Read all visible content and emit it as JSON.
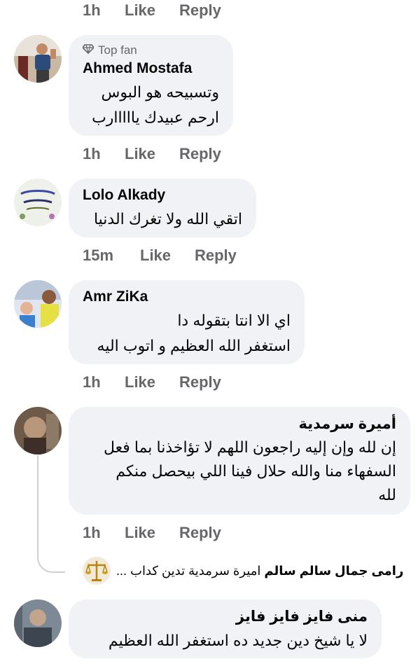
{
  "actions": {
    "like": "Like",
    "reply": "Reply"
  },
  "top_row": {
    "time": "1h"
  },
  "comments": [
    {
      "badge": "Top fan",
      "author": "Ahmed Mostafa",
      "lines": [
        "وتسبيحه هو البوس",
        "ارحم عبيدك يااااارب"
      ],
      "time": "1h"
    },
    {
      "author": "Lolo Alkady",
      "lines": [
        "اتقي الله ولا تغرك الدنيا"
      ],
      "time": "15m"
    },
    {
      "author": "Amr ZiKa",
      "lines": [
        "اي الا انتا بتقوله دا",
        "استغفر الله العظيم و اتوب اليه"
      ],
      "time": "1h"
    },
    {
      "author": "أميرة سرمدية",
      "lines": [
        "إن لله وإن إليه راجعون اللهم لا تؤاخذنا بما فعل",
        "السفهاء منا والله حلال فينا اللي بيحصل منكم",
        "لله"
      ],
      "time": "1h"
    },
    {
      "author": "منى فايز فايز فايز",
      "lines": [
        "لا يا شيخ دين جديد ده استغفر الله العظيم"
      ]
    }
  ],
  "reply_preview": {
    "author": "رامى جمال سالم سالم",
    "snippet": "اميرة سرمدية تدين كداب ..."
  },
  "icons": {
    "badge": "diamond-icon",
    "reply_avatar": "scales-icon"
  },
  "colors": {
    "bubble": "#f0f2f5",
    "meta": "#65676b",
    "text": "#050505"
  }
}
